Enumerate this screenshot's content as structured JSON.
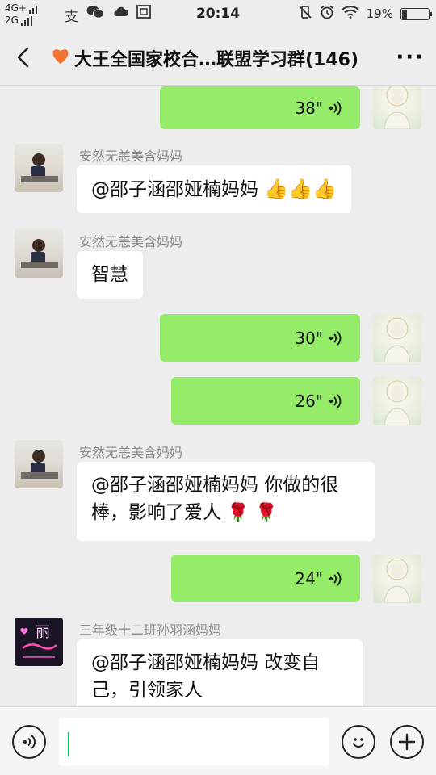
{
  "status_bar": {
    "network_top": "4G+",
    "network_bottom": "2G",
    "time": "20:14",
    "battery": "19%",
    "battery_level": 0.19
  },
  "header": {
    "title": "大王全国家校合…联盟学习群(146)",
    "more_label": "···"
  },
  "messages": [
    {
      "side": "right",
      "duration": "38\""
    },
    {
      "side": "left",
      "sender": "安然无恙美含妈妈",
      "text": "@邵子涵邵娅楠妈妈 "
    },
    {
      "side": "left",
      "sender": "安然无恙美含妈妈",
      "text": "智慧"
    },
    {
      "side": "right",
      "duration": "30\""
    },
    {
      "side": "right",
      "duration": "26\""
    },
    {
      "side": "left",
      "sender": "安然无恙美含妈妈",
      "text_line1": "@邵子涵邵娅楠妈妈  你做的很",
      "text_line2": "棒，影响了爱人"
    },
    {
      "side": "right",
      "duration": "24\""
    },
    {
      "side": "left",
      "sender": "三年级十二班孙羽涵妈妈",
      "avatar_text": "丽",
      "text_line1": "@邵子涵邵娅楠妈妈  改变自",
      "text_line2": "己，引领家人"
    }
  ],
  "icons": {
    "back": "chevron-left-icon",
    "voice_message": "voice-wave-icon",
    "thumbs_up": "thumbs-up-emoji",
    "rose": "rose-emoji",
    "voice_input": "voice-input-icon",
    "emoji": "emoji-icon",
    "plus": "plus-icon"
  },
  "colors": {
    "outgoing_bubble": "#95ec69",
    "incoming_bubble": "#ffffff",
    "background": "#ededed",
    "caret": "#07c160"
  }
}
